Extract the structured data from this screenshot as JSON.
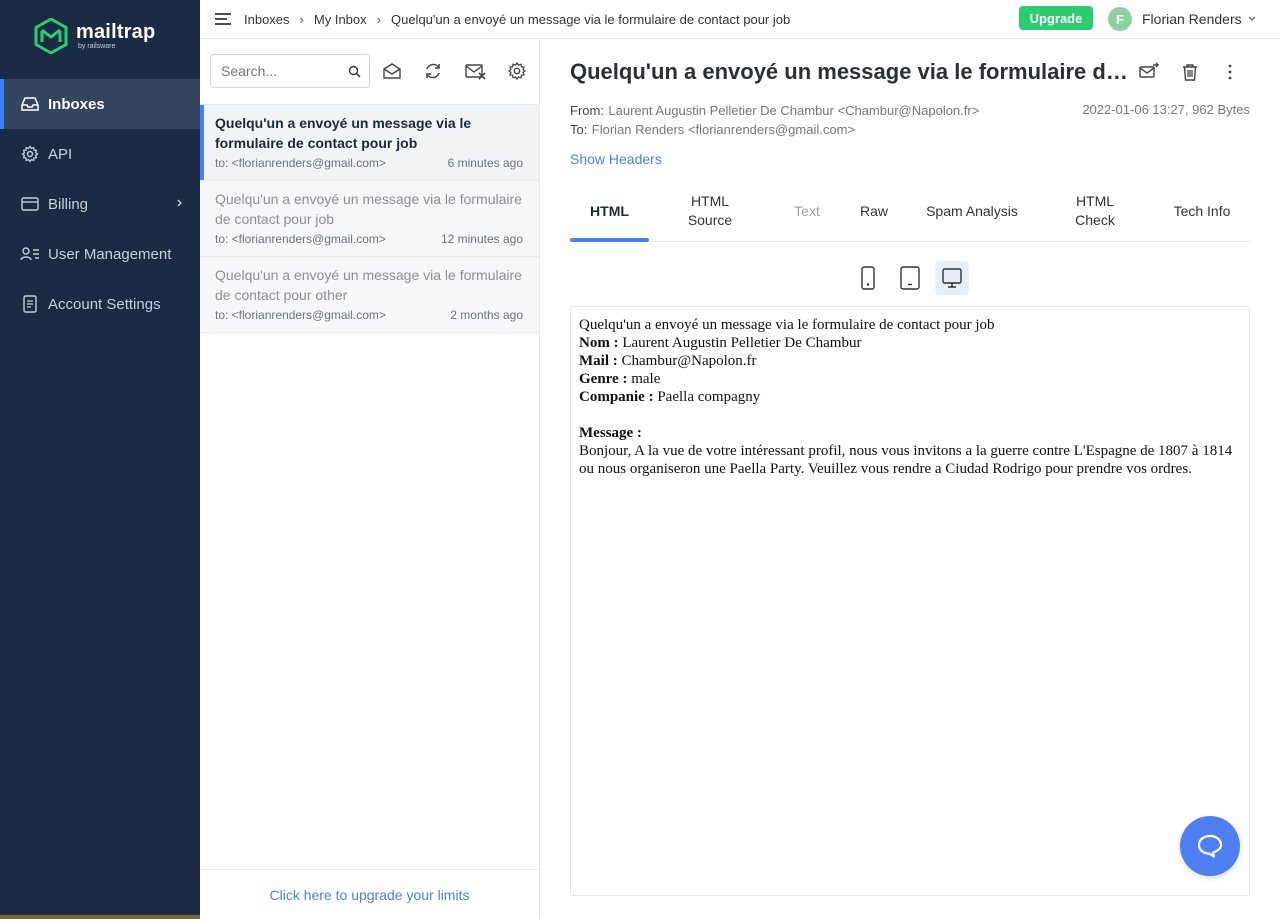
{
  "brand": {
    "name": "mailtrap",
    "sub": "by railsware"
  },
  "sidebar": {
    "items": [
      {
        "label": "Inboxes",
        "icon": "inbox-icon",
        "active": true
      },
      {
        "label": "API",
        "icon": "gear-icon"
      },
      {
        "label": "Billing",
        "icon": "credit-card-icon",
        "has_submenu": true
      },
      {
        "label": "User Management",
        "icon": "users-icon"
      },
      {
        "label": "Account Settings",
        "icon": "document-icon"
      }
    ]
  },
  "topbar": {
    "breadcrumbs": [
      "Inboxes",
      "My Inbox",
      "Quelqu'un a envoyé un message via le formulaire de contact pour job"
    ],
    "upgrade_label": "Upgrade",
    "user": {
      "initial": "F",
      "name": "Florian Renders"
    }
  },
  "search": {
    "placeholder": "Search..."
  },
  "messages": [
    {
      "subject": "Quelqu'un a envoyé un message via le formulaire de contact pour job",
      "to": "to: <florianrenders@gmail.com>",
      "time": "6 minutes ago",
      "active": true
    },
    {
      "subject": "Quelqu'un a envoyé un message via le formulaire de contact pour job",
      "to": "to: <florianrenders@gmail.com>",
      "time": "12 minutes ago"
    },
    {
      "subject": "Quelqu'un a envoyé un message via le formulaire de contact pour other",
      "to": "to: <florianrenders@gmail.com>",
      "time": "2 months ago"
    }
  ],
  "upgrade_link": "Click here to upgrade your limits",
  "message_view": {
    "title": "Quelqu'un a envoyé un message via le formulaire de contact pour job",
    "from_label": "From:",
    "from_value": "Laurent Augustin Pelletier De Chambur <Chambur@Napolon.fr>",
    "to_label": "To:",
    "to_value": "Florian Renders <florianrenders@gmail.com>",
    "date_info": "2022-01-06 13:27, 962 Bytes",
    "show_headers": "Show Headers",
    "tabs": [
      {
        "label": "HTML",
        "active": true
      },
      {
        "label": "HTML Source"
      },
      {
        "label": "Text",
        "disabled": true
      },
      {
        "label": "Raw"
      },
      {
        "label": "Spam Analysis"
      },
      {
        "label": "HTML Check"
      },
      {
        "label": "Tech Info"
      }
    ],
    "devices": [
      "mobile-device-icon",
      "tablet-device-icon",
      "desktop-device-icon"
    ]
  },
  "email_body": {
    "intro": "Quelqu'un a envoyé un message via le formulaire de contact pour job",
    "fields": [
      {
        "label": "Nom :",
        "value": "Laurent Augustin Pelletier De Chambur"
      },
      {
        "label": "Mail :",
        "value": "Chambur@Napolon.fr"
      },
      {
        "label": "Genre :",
        "value": "male"
      },
      {
        "label": "Companie :",
        "value": "Paella compagny"
      }
    ],
    "message_label": "Message :",
    "message_text": "Bonjour, A la vue de votre intéressant profil, nous vous invitons a la guerre contre L'Espagne de 1807 à 1814 ou nous organiseron une Paella Party. Veuillez vous rendre a Ciudad Rodrigo pour prendre vos ordres."
  },
  "colors": {
    "sidebar": "#1b2b44",
    "accent": "#4f7ef0",
    "upgrade": "#2ecc71"
  }
}
